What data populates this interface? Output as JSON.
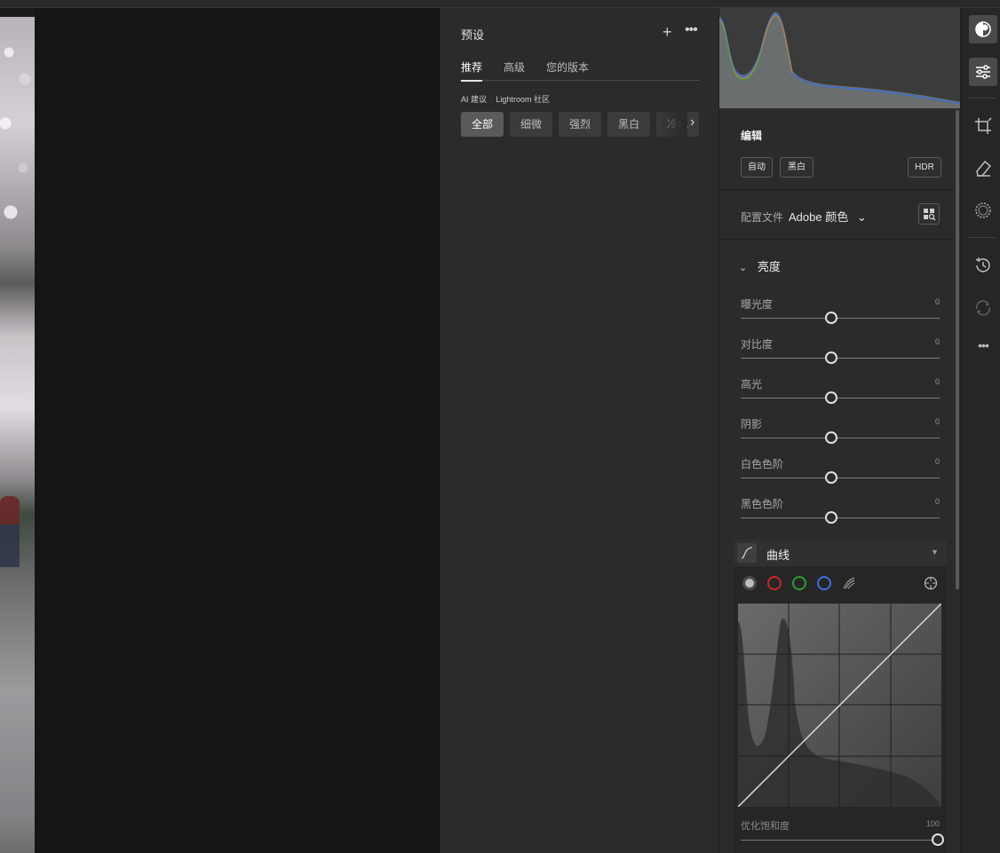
{
  "presets": {
    "title": "预设",
    "add_icon": "+",
    "more_icon": "•••",
    "tabs": [
      "推荐",
      "高级",
      "您的版本"
    ],
    "sources": [
      "AI 建议",
      "Lightroom 社区"
    ],
    "chips": [
      "全部",
      "细微",
      "强烈",
      "黑白",
      "冷色"
    ],
    "chevron": "›"
  },
  "edit": {
    "section_title": "编辑",
    "auto_label": "自动",
    "bw_label": "黑白",
    "hdr_label": "HDR",
    "profile_label": "配置文件",
    "profile_value": "Adobe 颜色",
    "profile_chevron": "⌄",
    "light_group": "亮度",
    "group_chevron": "⌄",
    "sliders": [
      {
        "label": "曝光度",
        "value": "0",
        "level": 0.5
      },
      {
        "label": "对比度",
        "value": "0",
        "level": 0.5
      },
      {
        "label": "高光",
        "value": "0",
        "level": 0.5
      },
      {
        "label": "阴影",
        "value": "0",
        "level": 0.5
      },
      {
        "label": "白色色阶",
        "value": "0",
        "level": 0.5
      },
      {
        "label": "黑色色阶",
        "value": "0",
        "level": 0.5
      }
    ],
    "curve": {
      "title": "曲线",
      "arrow": "▼",
      "channels": [
        "rgb",
        "red",
        "green",
        "blue"
      ],
      "saturation_label": "优化饱和度",
      "saturation_value": "100",
      "saturation_level": 1.0
    }
  },
  "rail": {
    "icons": [
      "adjust-icon",
      "edit-sliders-icon",
      "crop-icon",
      "eraser-icon",
      "mask-icon",
      "history-icon",
      "sync-icon",
      "more-icon"
    ],
    "more_icon": "•••"
  },
  "colors": {
    "accent": "#e0e0e0",
    "panel": "#2b2b2b",
    "red_channel": "#c62828",
    "green_channel": "#2e9c3a",
    "blue_channel": "#3f6fd9"
  }
}
